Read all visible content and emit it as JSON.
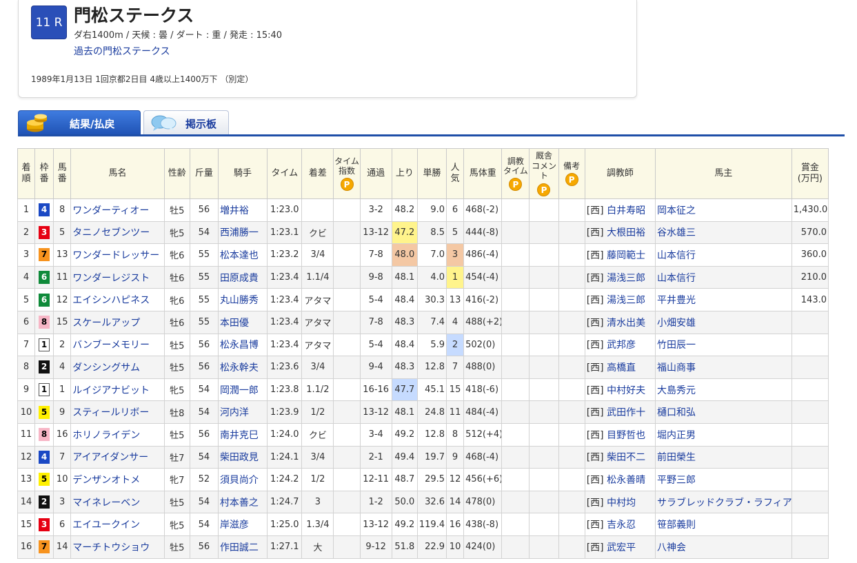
{
  "race": {
    "number": "11 R",
    "title": "門松ステークス",
    "meta": "ダ右1400m / 天候 : 曇 / ダート : 重 / 発走 : 15:40",
    "past_link": "過去の門松ステークス",
    "info": "1989年1月13日 1回京都2日目 4歳以上1400万下 （別定）"
  },
  "tabs": {
    "results": "結果/払戻",
    "board": "掲示板"
  },
  "headers": {
    "rank_l1": "着",
    "rank_l2": "順",
    "waku_l1": "枠",
    "waku_l2": "番",
    "umaban_l1": "馬",
    "umaban_l2": "番",
    "horse": "馬名",
    "sexage": "性齢",
    "weight": "斤量",
    "jockey": "騎手",
    "time": "タイム",
    "margin": "着差",
    "timeidx_l1": "タイム",
    "timeidx_l2": "指数",
    "passing": "通過",
    "last3f": "上り",
    "odds": "単勝",
    "pop_l1": "人",
    "pop_l2": "気",
    "bodyweight": "馬体重",
    "chokyo_l1": "調教",
    "chokyo_l2": "タイム",
    "comment_l1": "厩舎",
    "comment_l2": "コメント",
    "remarks": "備考",
    "trainer": "調教師",
    "owner": "馬主",
    "prize_l1": "賞金",
    "prize_l2": "(万円)",
    "premium_mark": "P"
  },
  "rows": [
    {
      "rank": "1",
      "waku": "4",
      "umaban": "8",
      "horse": "ワンダーティオー",
      "sexage": "牡5",
      "weight": "56",
      "jockey": "増井裕",
      "time": "1:23.0",
      "margin": "",
      "passing": "3-2",
      "last3f": "48.2",
      "odds": "9.0",
      "pop": "6",
      "bw": "468(-2)",
      "region": "[西]",
      "trainer": "白井寿昭",
      "owner": "岡本征之",
      "prize": "1,430.0"
    },
    {
      "rank": "2",
      "waku": "3",
      "umaban": "5",
      "horse": "タニノセブンツー",
      "sexage": "牝5",
      "weight": "54",
      "jockey": "西浦勝一",
      "time": "1:23.1",
      "margin": "クビ",
      "passing": "13-12",
      "last3f": "47.2",
      "odds": "8.5",
      "pop": "5",
      "bw": "444(-8)",
      "region": "[西]",
      "trainer": "大根田裕",
      "owner": "谷水雄三",
      "prize": "570.0"
    },
    {
      "rank": "3",
      "waku": "7",
      "umaban": "13",
      "horse": "ワンダードレッサー",
      "sexage": "牝6",
      "weight": "55",
      "jockey": "松本達也",
      "time": "1:23.2",
      "margin": "3/4",
      "passing": "7-8",
      "last3f": "48.0",
      "odds": "7.0",
      "pop": "3",
      "bw": "486(-4)",
      "region": "[西]",
      "trainer": "藤岡範士",
      "owner": "山本信行",
      "prize": "360.0"
    },
    {
      "rank": "4",
      "waku": "6",
      "umaban": "11",
      "horse": "ワンダーレジスト",
      "sexage": "牡6",
      "weight": "55",
      "jockey": "田原成貴",
      "time": "1:23.4",
      "margin": "1.1/4",
      "passing": "9-8",
      "last3f": "48.1",
      "odds": "4.0",
      "pop": "1",
      "bw": "454(-4)",
      "region": "[西]",
      "trainer": "湯浅三郎",
      "owner": "山本信行",
      "prize": "210.0"
    },
    {
      "rank": "5",
      "waku": "6",
      "umaban": "12",
      "horse": "エイシンハピネス",
      "sexage": "牝6",
      "weight": "55",
      "jockey": "丸山勝秀",
      "time": "1:23.4",
      "margin": "アタマ",
      "passing": "5-4",
      "last3f": "48.4",
      "odds": "30.3",
      "pop": "13",
      "bw": "416(-2)",
      "region": "[西]",
      "trainer": "湯浅三郎",
      "owner": "平井豊光",
      "prize": "143.0"
    },
    {
      "rank": "6",
      "waku": "8",
      "umaban": "15",
      "horse": "スケールアップ",
      "sexage": "牡6",
      "weight": "55",
      "jockey": "本田優",
      "time": "1:23.4",
      "margin": "アタマ",
      "passing": "7-8",
      "last3f": "48.3",
      "odds": "7.4",
      "pop": "4",
      "bw": "488(+2)",
      "region": "[西]",
      "trainer": "清水出美",
      "owner": "小畑安雄",
      "prize": ""
    },
    {
      "rank": "7",
      "waku": "1",
      "umaban": "2",
      "horse": "バンブーメモリー",
      "sexage": "牡5",
      "weight": "56",
      "jockey": "松永昌博",
      "time": "1:23.4",
      "margin": "アタマ",
      "passing": "5-4",
      "last3f": "48.4",
      "odds": "5.9",
      "pop": "2",
      "bw": "502(0)",
      "region": "[西]",
      "trainer": "武邦彦",
      "owner": "竹田辰一",
      "prize": ""
    },
    {
      "rank": "8",
      "waku": "2",
      "umaban": "4",
      "horse": "ダンシングサム",
      "sexage": "牡5",
      "weight": "56",
      "jockey": "松永幹夫",
      "time": "1:23.6",
      "margin": "3/4",
      "passing": "9-4",
      "last3f": "48.3",
      "odds": "12.8",
      "pop": "7",
      "bw": "488(0)",
      "region": "[西]",
      "trainer": "高橋直",
      "owner": "福山商事",
      "prize": ""
    },
    {
      "rank": "9",
      "waku": "1",
      "umaban": "1",
      "horse": "ルイジアナビット",
      "sexage": "牝5",
      "weight": "54",
      "jockey": "岡潤一郎",
      "time": "1:23.8",
      "margin": "1.1/2",
      "passing": "16-16",
      "last3f": "47.7",
      "odds": "45.1",
      "pop": "15",
      "bw": "418(-6)",
      "region": "[西]",
      "trainer": "中村好夫",
      "owner": "大島秀元",
      "prize": ""
    },
    {
      "rank": "10",
      "waku": "5",
      "umaban": "9",
      "horse": "スティールリボー",
      "sexage": "牡8",
      "weight": "54",
      "jockey": "河内洋",
      "time": "1:23.9",
      "margin": "1/2",
      "passing": "13-12",
      "last3f": "48.1",
      "odds": "24.8",
      "pop": "11",
      "bw": "484(-4)",
      "region": "[西]",
      "trainer": "武田作十",
      "owner": "樋口和弘",
      "prize": ""
    },
    {
      "rank": "11",
      "waku": "8",
      "umaban": "16",
      "horse": "ホリノライデン",
      "sexage": "牡5",
      "weight": "56",
      "jockey": "南井克巳",
      "time": "1:24.0",
      "margin": "クビ",
      "passing": "3-4",
      "last3f": "49.2",
      "odds": "12.8",
      "pop": "8",
      "bw": "512(+4)",
      "region": "[西]",
      "trainer": "目野哲也",
      "owner": "堀内正男",
      "prize": ""
    },
    {
      "rank": "12",
      "waku": "4",
      "umaban": "7",
      "horse": "アイアイダンサー",
      "sexage": "牡7",
      "weight": "54",
      "jockey": "柴田政見",
      "time": "1:24.1",
      "margin": "3/4",
      "passing": "2-1",
      "last3f": "49.4",
      "odds": "19.7",
      "pop": "9",
      "bw": "468(-4)",
      "region": "[西]",
      "trainer": "柴田不二",
      "owner": "前田榮生",
      "prize": ""
    },
    {
      "rank": "13",
      "waku": "5",
      "umaban": "10",
      "horse": "デンザンオトメ",
      "sexage": "牝7",
      "weight": "52",
      "jockey": "須貝尚介",
      "time": "1:24.2",
      "margin": "1/2",
      "passing": "12-11",
      "last3f": "48.7",
      "odds": "29.5",
      "pop": "12",
      "bw": "456(+6)",
      "region": "[西]",
      "trainer": "松永善晴",
      "owner": "平野三郎",
      "prize": ""
    },
    {
      "rank": "14",
      "waku": "2",
      "umaban": "3",
      "horse": "マイネレーベン",
      "sexage": "牡5",
      "weight": "54",
      "jockey": "村本善之",
      "time": "1:24.7",
      "margin": "3",
      "passing": "1-2",
      "last3f": "50.0",
      "odds": "32.6",
      "pop": "14",
      "bw": "478(0)",
      "region": "[西]",
      "trainer": "中村均",
      "owner": "サラブレッドクラブ・ラフィアン",
      "prize": ""
    },
    {
      "rank": "15",
      "waku": "3",
      "umaban": "6",
      "horse": "エイユークイン",
      "sexage": "牝5",
      "weight": "54",
      "jockey": "岸滋彦",
      "time": "1:25.0",
      "margin": "1.3/4",
      "passing": "13-12",
      "last3f": "49.2",
      "odds": "119.4",
      "pop": "16",
      "bw": "438(-8)",
      "region": "[西]",
      "trainer": "吉永忍",
      "owner": "笹部義則",
      "prize": ""
    },
    {
      "rank": "16",
      "waku": "7",
      "umaban": "14",
      "horse": "マーチトウショウ",
      "sexage": "牡5",
      "weight": "56",
      "jockey": "作田誠二",
      "time": "1:27.1",
      "margin": "大",
      "passing": "9-12",
      "last3f": "51.8",
      "odds": "22.9",
      "pop": "10",
      "bw": "424(0)",
      "region": "[西]",
      "trainer": "武宏平",
      "owner": "八神会",
      "prize": ""
    }
  ],
  "highlights": {
    "last3f": {
      "2": "yellow",
      "3": "orange",
      "9": "blue"
    },
    "pop": {
      "3": "orange",
      "4": "yellow",
      "7": "blue"
    }
  }
}
